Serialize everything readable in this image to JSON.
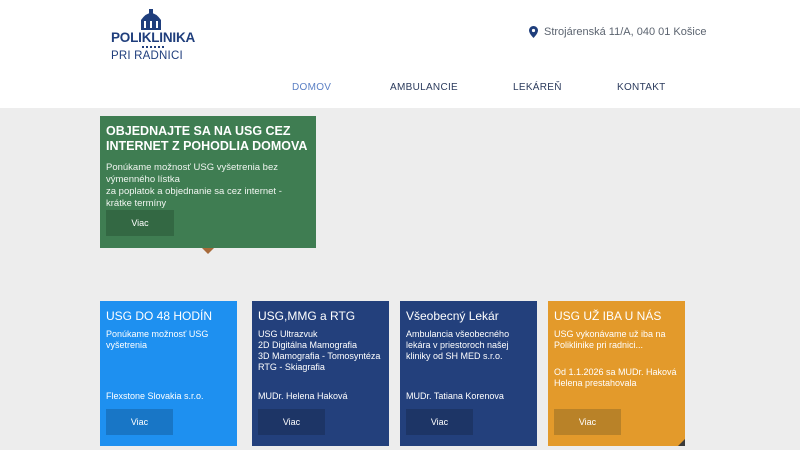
{
  "logo": {
    "line1": "POLIKLINIKA",
    "line2": "PRI RADNICI"
  },
  "address": "Strojárenská 11/A, 040 01 Košice",
  "nav": [
    "DOMOV",
    "AMBULANCIE",
    "LEKÁREŇ",
    "KONTAKT"
  ],
  "hero": {
    "title": "OBJEDNAJTE SA NA USG CEZ INTERNET Z POHODLIA DOMOVA",
    "text1": "Ponúkame možnosť USG vyšetrenia bez výmenného lístka",
    "text2": "za poplatok a objednanie sa cez internet - krátke termíny",
    "button": "Viac"
  },
  "cards": [
    {
      "title": "USG DO 48 HODÍN",
      "desc": "Ponúkame možnosť USG vyšetrenia",
      "sub": "Flexstone Slovakia s.r.o.",
      "button": "Viac"
    },
    {
      "title": "USG,MMG a RTG",
      "desc": "USG Ultrazvuk\n2D Digitálna Mamografia\n3D Mamografia - Tomosyntéza\nRTG - Skiagrafia",
      "sub": "MUDr. Helena Haková",
      "button": "Viac"
    },
    {
      "title": "Všeobecný Lekár",
      "desc": "Ambulancia všeobecného lekára v priestoroch našej kliniky od SH MED s.r.o.",
      "sub": "MUDr. Tatiana Korenova",
      "button": "Viac"
    },
    {
      "title": "USG UŽ IBA U NÁS",
      "desc": "USG vykonávame už iba na Poliklinike pri radnici...",
      "sub": "Od 1.1.2026 sa MUDr. Haková Helena prestahovala",
      "button": "Viac"
    }
  ],
  "colors": {
    "hero": "#3f7d52",
    "card_blue": "#1e90f0",
    "card_navy": "#23407c",
    "card_orange": "#e39a2b",
    "brand": "#1f3e7c"
  }
}
